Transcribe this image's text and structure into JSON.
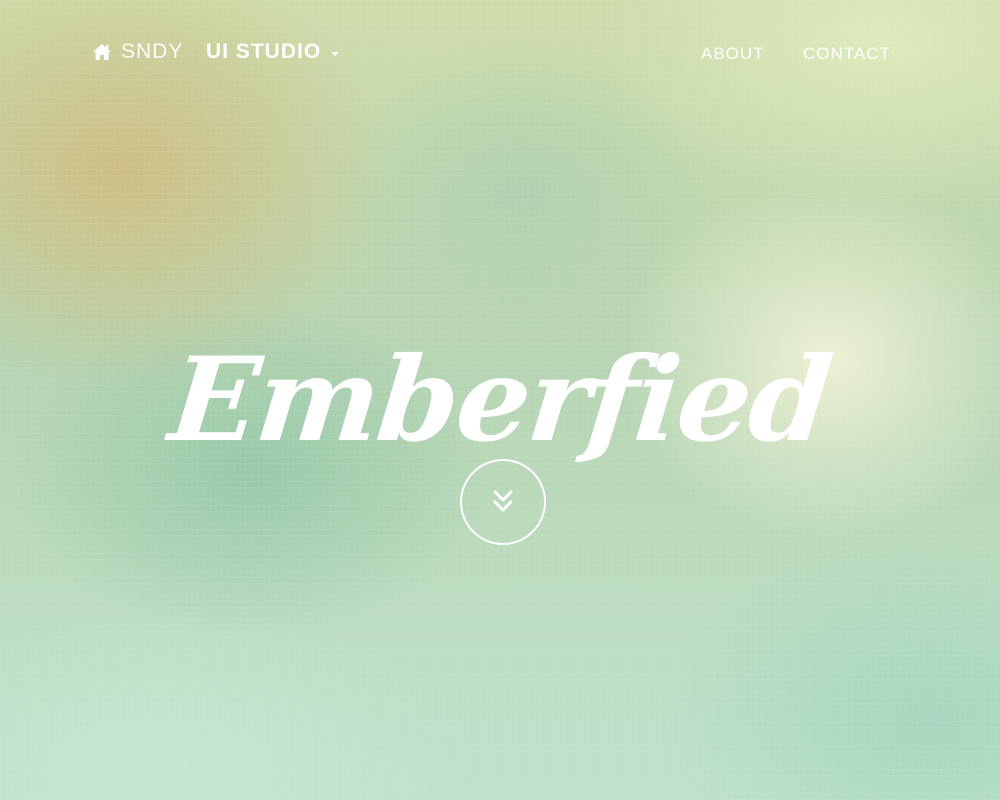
{
  "nav": {
    "brand": {
      "icon": "home-icon",
      "label": "SNDY"
    },
    "dropdown": {
      "label": "UI STUDIO",
      "icon": "caret-down-icon"
    },
    "links": [
      {
        "label": "ABOUT"
      },
      {
        "label": "CONTACT"
      }
    ]
  },
  "hero": {
    "title": "Emberfied",
    "scroll_icon": "double-chevron-down-icon"
  },
  "colors": {
    "text": "#ffffff",
    "background_gold": "#ceb880",
    "background_mint": "#bfe2cc",
    "background_cream": "#f0f2d4"
  }
}
